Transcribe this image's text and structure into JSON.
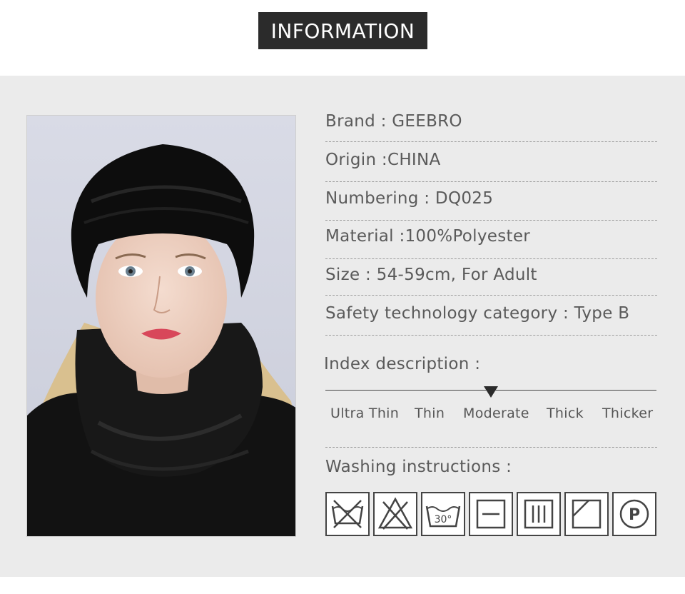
{
  "header": {
    "title": "INFORMATION"
  },
  "info": {
    "brand": "Brand : GEEBRO",
    "origin": "Origin :CHINA",
    "numbering": "Numbering : DQ025",
    "material": "Material :100%Polyester",
    "size": "Size : 54-59cm, For Adult",
    "safety": "Safety technology category : Type B"
  },
  "index": {
    "label": "Index description :",
    "levels": [
      "Ultra Thin",
      "Thin",
      "Moderate",
      "Thick",
      "Thicker"
    ],
    "selected": "Moderate"
  },
  "washing": {
    "label": "Washing instructions :",
    "icons": [
      "do-not-wash-icon",
      "do-not-bleach-icon",
      "wash-30-icon",
      "dry-flat-icon",
      "drip-dry-icon",
      "dry-in-shade-icon",
      "dry-clean-p-icon"
    ],
    "temperature": "30°",
    "dry_clean_letter": "P"
  },
  "colors": {
    "panel": "#ebebeb",
    "title_bg": "#2b2b2b",
    "text": "#5a5a5a"
  }
}
